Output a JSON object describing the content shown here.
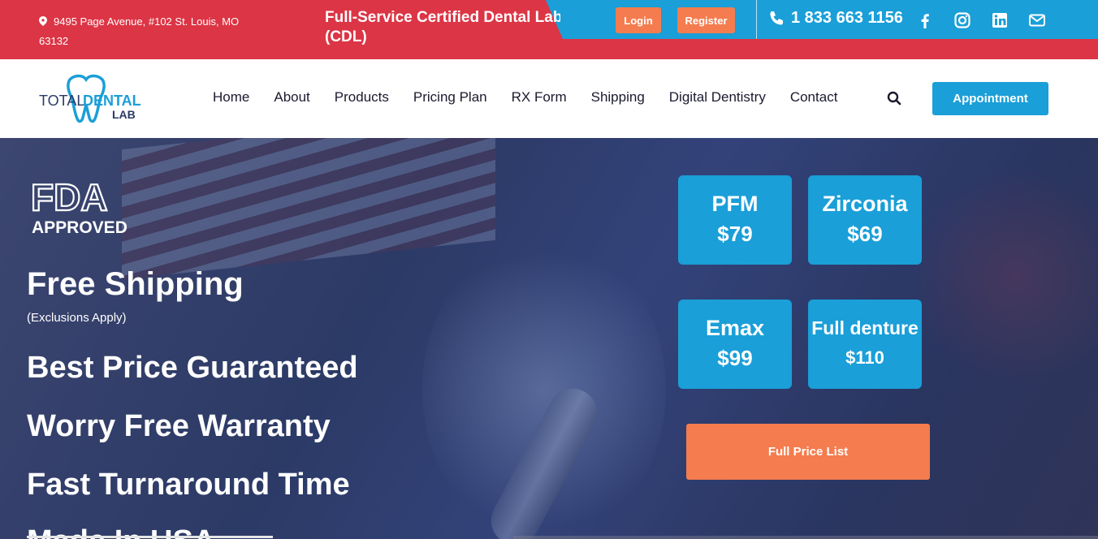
{
  "topbar": {
    "address": "9495 Page Avenue, #102 St. Louis, MO 63132",
    "headline": "Full-Service Certified Dental Lab (CDL)",
    "login_label": "Login",
    "register_label": "Register",
    "phone": "1 833 663 1156",
    "social_icons": [
      "facebook-icon",
      "instagram-icon",
      "linkedin-icon",
      "email-icon"
    ]
  },
  "logo": {
    "line1_a": "TOTAL",
    "line1_b": "DENTAL",
    "line2": "LAB"
  },
  "nav": {
    "items": [
      "Home",
      "About",
      "Products",
      "Pricing Plan",
      "RX Form",
      "Shipping",
      "Digital Dentistry",
      "Contact"
    ],
    "appointment_label": "Appointment"
  },
  "hero": {
    "fda_top": "FDA",
    "fda_bottom": "APPROVED",
    "free_shipping": "Free Shipping",
    "exclusions": "(Exclusions Apply)",
    "claim_price": "Best Price Guaranteed",
    "claim_warranty": "Worry Free Warranty",
    "claim_turnaround": "Fast Turnaround Time",
    "claim_usa": "Made In USA",
    "prices": [
      {
        "name": "PFM",
        "price": "$79"
      },
      {
        "name": "Zirconia",
        "price": "$69"
      },
      {
        "name": "Emax",
        "price": "$99"
      },
      {
        "name": "Full denture",
        "price": "$110"
      }
    ],
    "full_price_label": "Full Price List"
  },
  "colors": {
    "red": "#dc3545",
    "blue": "#1a9fd8",
    "orange": "#f47c4e",
    "hero_overlay": "#2c3a66"
  }
}
